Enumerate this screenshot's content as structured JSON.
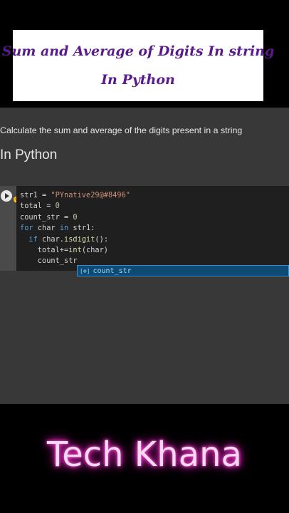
{
  "title_card": {
    "line1": "Sum and Average of Digits In string",
    "line2": "In Python"
  },
  "notebook": {
    "markdown_text": "Calculate the sum and average of the digits present in a string",
    "markdown_heading": "In Python",
    "code_lines": [
      "str1 = \"PYnative29@#8496\"",
      "total = 0",
      "count_str = 0",
      "for char in str1:",
      "  if char.isdigit():",
      "    total+=int(char)",
      "    count_str"
    ],
    "autocomplete": {
      "icon": "[⊗]",
      "label": "count_str"
    }
  },
  "brand": {
    "text": "Tech Khana"
  }
}
